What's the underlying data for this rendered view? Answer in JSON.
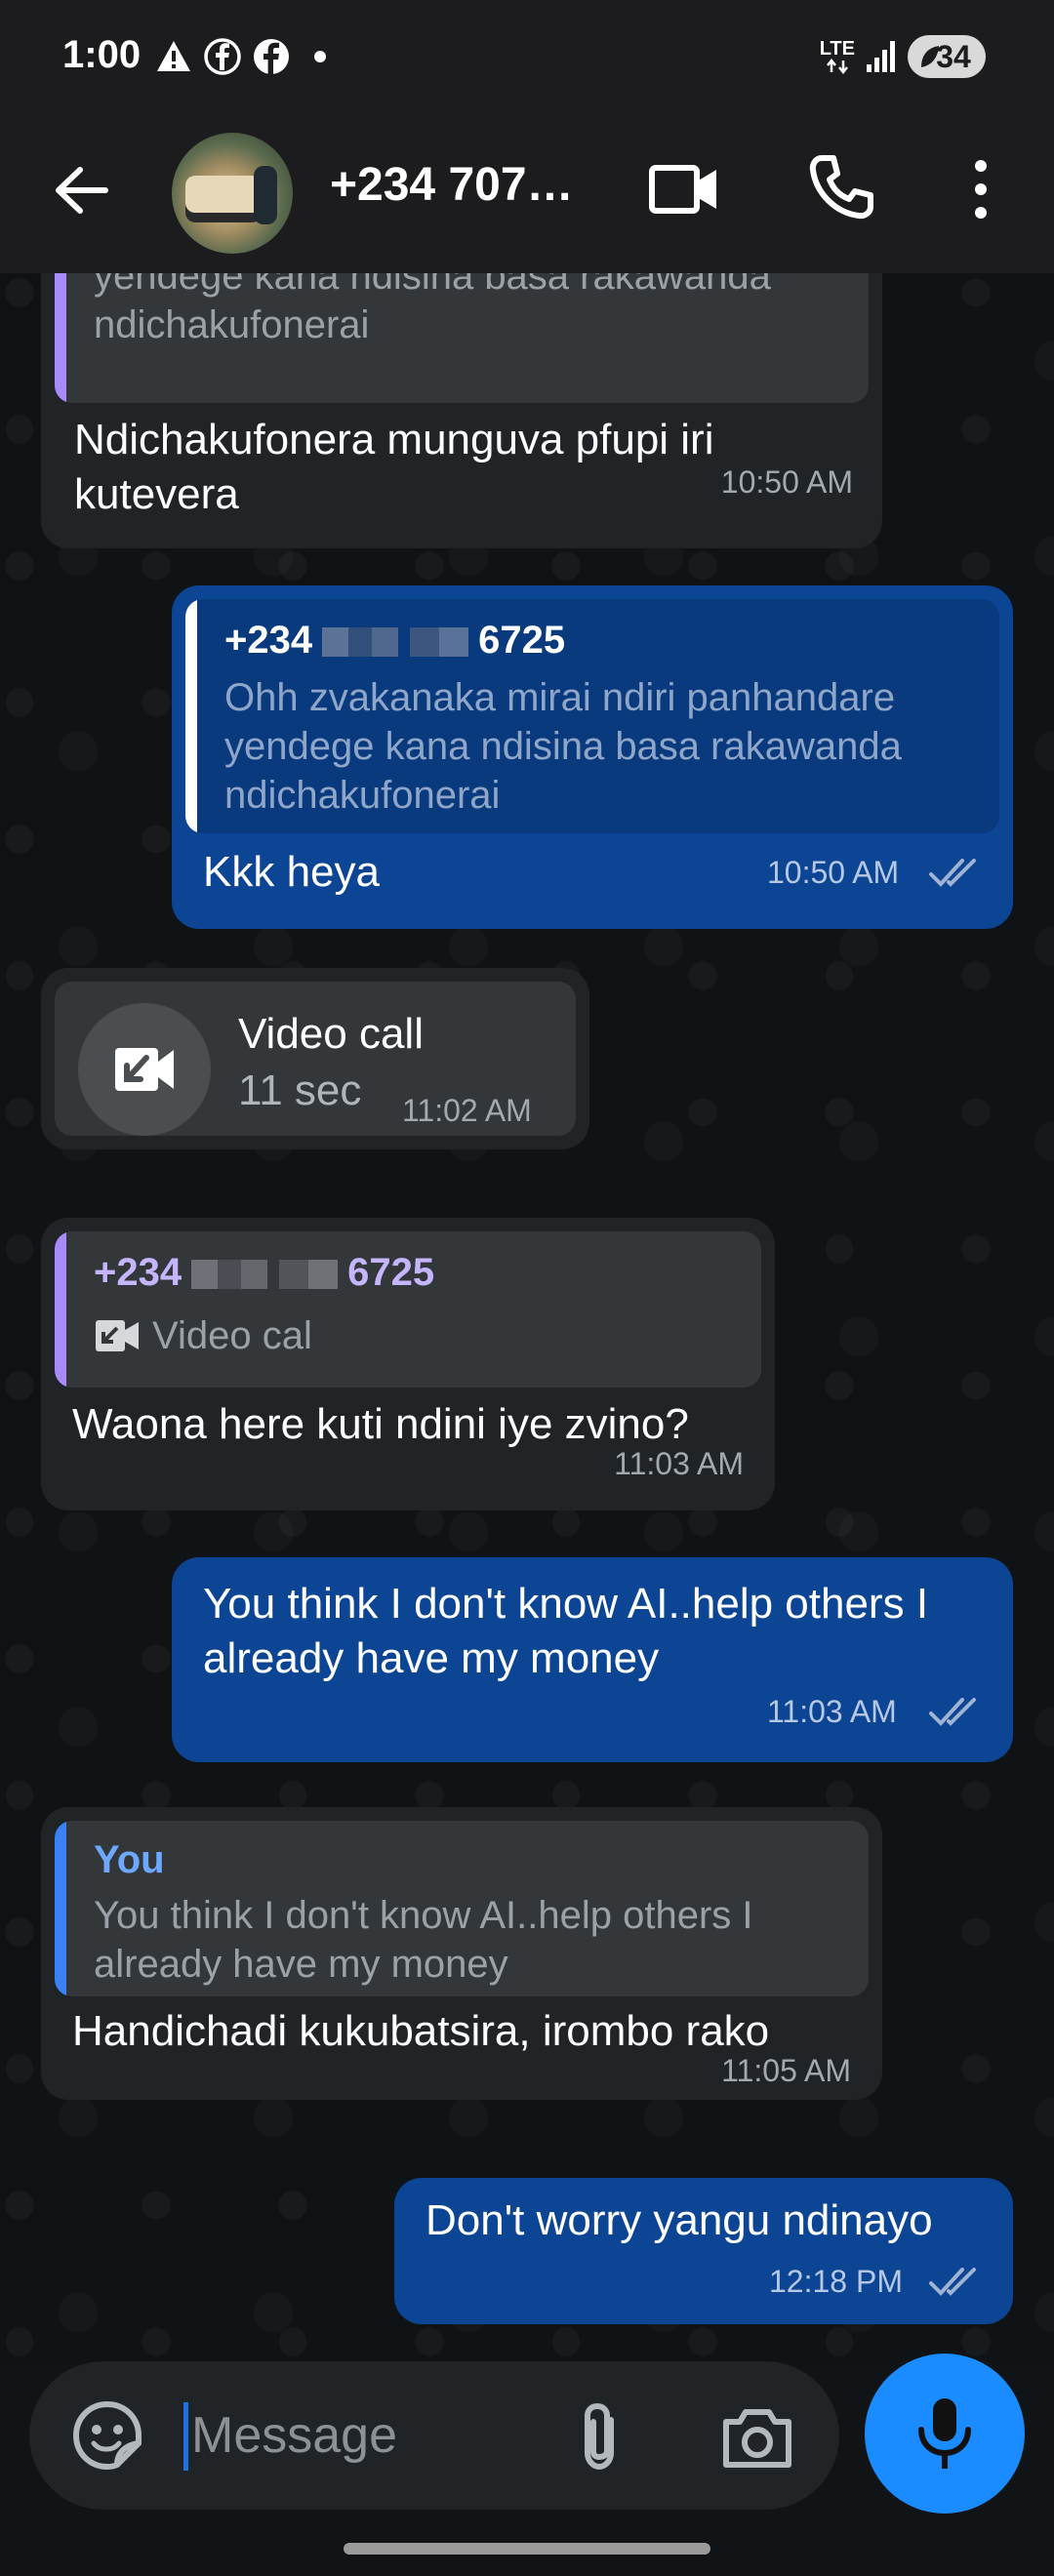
{
  "status_bar": {
    "time": "1:00",
    "network": "LTE",
    "battery": "34",
    "icons": [
      "warning-icon",
      "facebook-icon",
      "facebook-icon",
      "dot-icon",
      "signal-icon",
      "battery-icon"
    ]
  },
  "header": {
    "contact": "+234 707…",
    "icons": [
      "back-arrow-icon",
      "avatar",
      "video-camera-icon",
      "phone-icon",
      "more-vert-icon"
    ]
  },
  "messages": [
    {
      "dir": "in",
      "quote_text": "Ohh zvakanaka mirai ndiri panhandare yendege kana ndisina basa rakawanda ndichakufonerai",
      "text": "Ndichakufonera munguva pfupi iri kutevera",
      "time": "10:50 AM"
    },
    {
      "dir": "out",
      "quote_name_prefix": "+234",
      "quote_name_suffix": "6725",
      "quote_text": "Ohh zvakanaka mirai ndiri panhandare yendege kana ndisina basa rakawanda ndichakufonerai",
      "text": "Kkk heya",
      "time": "10:50 AM"
    },
    {
      "dir": "in",
      "type": "call",
      "title": "Video call",
      "duration": "11 sec",
      "time": "11:02 AM"
    },
    {
      "dir": "in",
      "quote_name_prefix": "+234",
      "quote_name_suffix": "6725",
      "quote_text": "Video cal",
      "text": "Waona here kuti ndini iye zvino?",
      "time": "11:03 AM"
    },
    {
      "dir": "out",
      "text": "You think I don't know AI..help others I already have my money",
      "time": "11:03 AM"
    },
    {
      "dir": "in",
      "quote_name": "You",
      "quote_text": "You think I don't know AI..help others I already have my money",
      "text": "Handichadi kukubatsira, irombo rako",
      "time": "11:05 AM"
    },
    {
      "dir": "out",
      "text": "Don't worry yangu ndinayo",
      "time": "12:18 PM"
    }
  ],
  "composer": {
    "placeholder": "Message",
    "icons": [
      "sticker-icon",
      "attach-icon",
      "camera-icon",
      "mic-icon"
    ]
  },
  "colors": {
    "outgoing_bubble": "#0c4594",
    "incoming_bubble": "#202427",
    "accent": "#1a8cff",
    "quote_bar_purple": "#a78bfa",
    "quote_bar_blue": "#3b82f6"
  }
}
